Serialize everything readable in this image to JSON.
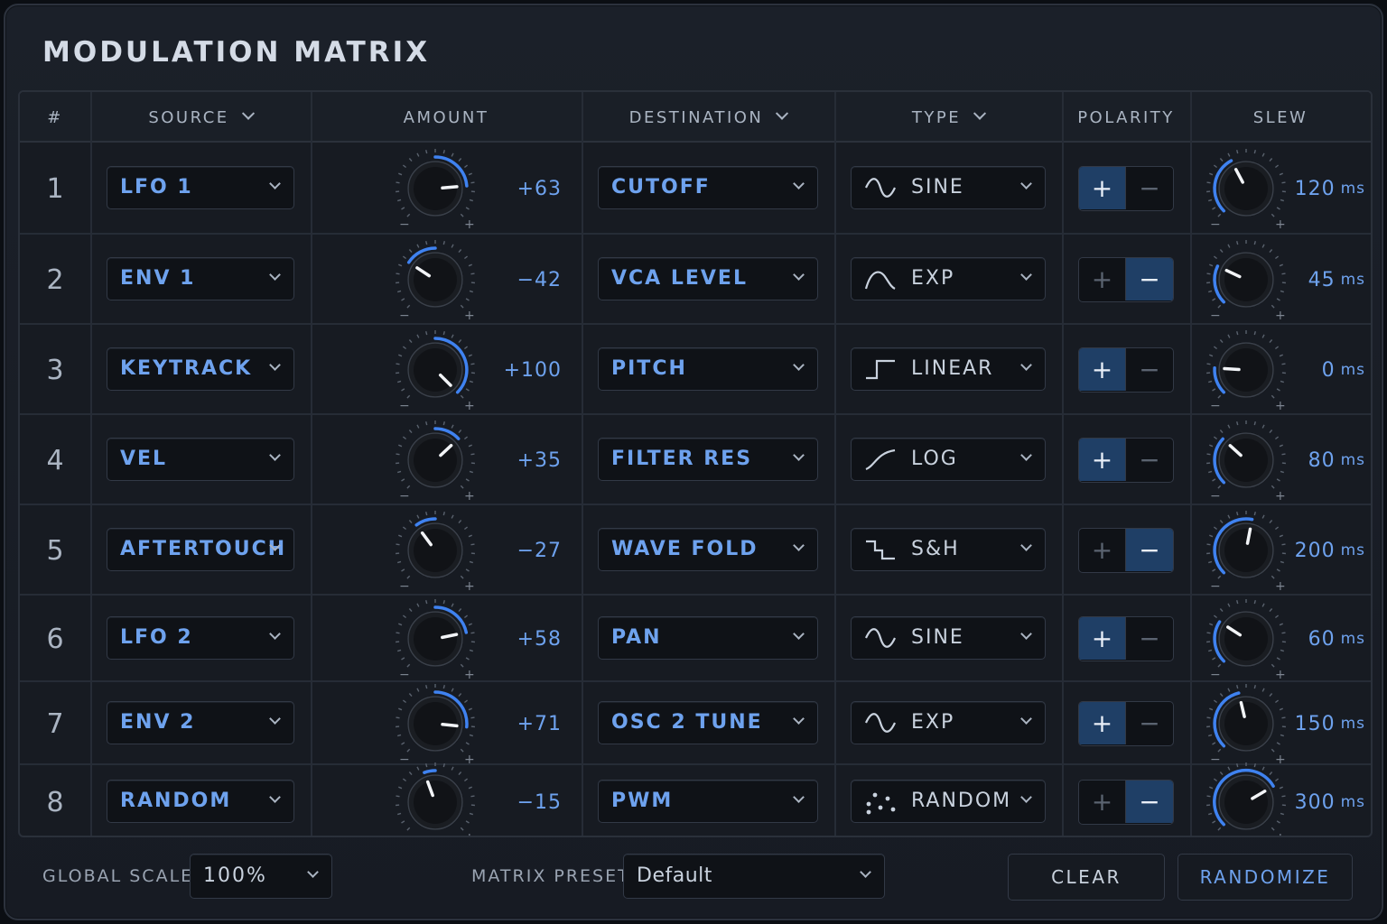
{
  "title": "MODULATION MATRIX",
  "headers": {
    "num": "#",
    "source": "SOURCE",
    "amount": "AMOUNT",
    "destination": "DESTINATION",
    "type": "TYPE",
    "polarity": "POLARITY",
    "slew": "SLEW"
  },
  "polarity_symbols": {
    "plus": "+",
    "minus": "−"
  },
  "slew_unit": "ms",
  "rows": [
    {
      "num": "1",
      "source": "LFO 1",
      "amount": "+63",
      "amount_value": 63,
      "destination": "CUTOFF",
      "type": "SINE",
      "type_icon": "sine-wave-icon",
      "polarity": "plus",
      "slew": "120",
      "slew_value": 120
    },
    {
      "num": "2",
      "source": "ENV 1",
      "amount": "−42",
      "amount_value": -42,
      "destination": "VCA LEVEL",
      "type": "EXP",
      "type_icon": "exp-curve-icon",
      "polarity": "minus",
      "slew": "45",
      "slew_value": 45
    },
    {
      "num": "3",
      "source": "KEYTRACK",
      "amount": "+100",
      "amount_value": 100,
      "destination": "PITCH",
      "type": "LINEAR",
      "type_icon": "linear-step-icon",
      "polarity": "plus",
      "slew": "0",
      "slew_value": 0
    },
    {
      "num": "4",
      "source": "VEL",
      "amount": "+35",
      "amount_value": 35,
      "destination": "FILTER RES",
      "type": "LOG",
      "type_icon": "log-curve-icon",
      "polarity": "plus",
      "slew": "80",
      "slew_value": 80
    },
    {
      "num": "5",
      "source": "AFTERTOUCH",
      "amount": "−27",
      "amount_value": -27,
      "destination": "WAVE FOLD",
      "type": "S&H",
      "type_icon": "sample-hold-icon",
      "polarity": "minus",
      "slew": "200",
      "slew_value": 200
    },
    {
      "num": "6",
      "source": "LFO 2",
      "amount": "+58",
      "amount_value": 58,
      "destination": "PAN",
      "type": "SINE",
      "type_icon": "sine-wave-icon",
      "polarity": "plus",
      "slew": "60",
      "slew_value": 60
    },
    {
      "num": "7",
      "source": "ENV 2",
      "amount": "+71",
      "amount_value": 71,
      "destination": "OSC 2 TUNE",
      "type": "EXP",
      "type_icon": "sine-wave-icon",
      "polarity": "plus",
      "slew": "150",
      "slew_value": 150
    },
    {
      "num": "8",
      "source": "RANDOM",
      "amount": "−15",
      "amount_value": -15,
      "destination": "PWM",
      "type": "RANDOM",
      "type_icon": "random-dots-icon",
      "polarity": "minus",
      "slew": "300",
      "slew_value": 300
    }
  ],
  "footer": {
    "global_scale_label": "GLOBAL SCALE",
    "global_scale_value": "100%",
    "preset_label": "MATRIX PRESET",
    "preset_value": "Default",
    "clear_label": "CLEAR",
    "randomize_label": "RANDOMIZE"
  },
  "colors": {
    "accent": "#6ea2ee",
    "active_button": "#1f3f66",
    "panel": "#1b2029",
    "field": "#0f1217"
  }
}
